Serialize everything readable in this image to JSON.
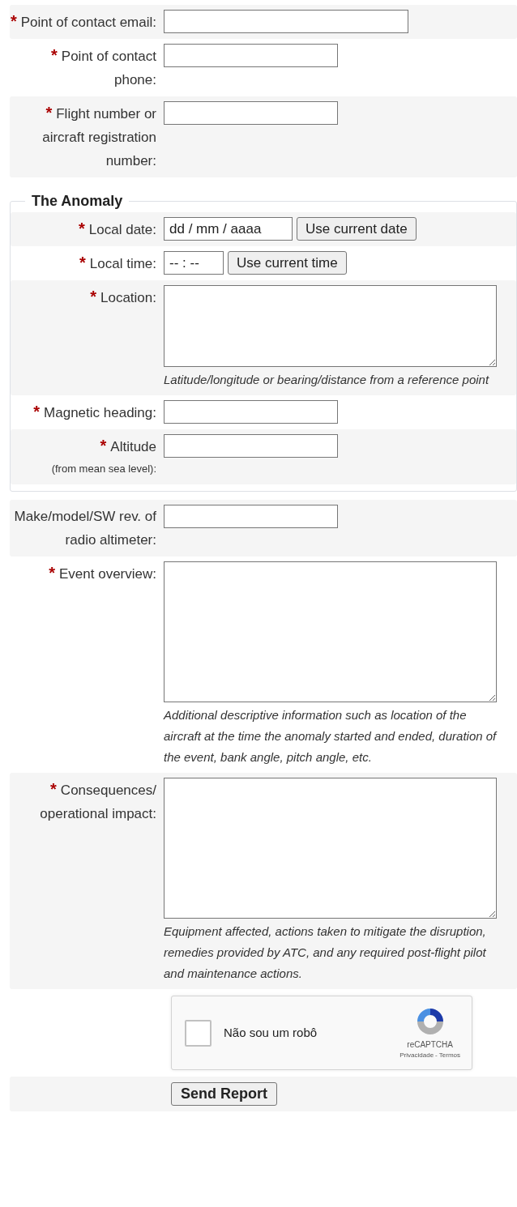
{
  "required_mark": "*",
  "contact_rows": [
    {
      "label": "Point of contact email:",
      "required": true,
      "kind": "wide_text"
    },
    {
      "label": "Point of contact phone:",
      "required": true,
      "kind": "text"
    },
    {
      "label": "Flight number or aircraft registration number:",
      "required": true,
      "kind": "text"
    }
  ],
  "anomaly": {
    "legend": "The Anomaly",
    "rows": [
      {
        "label": "Local date:",
        "required": true,
        "kind": "date",
        "placeholder": "dd / mm / aaaa",
        "button": "Use current date"
      },
      {
        "label": "Local time:",
        "required": true,
        "kind": "time",
        "placeholder": "-- : --",
        "button": "Use current time"
      },
      {
        "label": "Location:",
        "required": true,
        "kind": "textarea_short",
        "hint": "Latitude/longitude or bearing/distance from a reference point"
      },
      {
        "label": "Magnetic heading:",
        "required": true,
        "kind": "text"
      },
      {
        "label": "Altitude",
        "sublabel": "(from mean sea level):",
        "required": true,
        "kind": "text"
      }
    ]
  },
  "detail_rows": [
    {
      "label": "Make/model/SW rev. of radio altimeter:",
      "required": false,
      "kind": "text"
    },
    {
      "label": "Event overview:",
      "required": true,
      "kind": "textarea",
      "hint": "Additional descriptive information such as location of the aircraft at the time the anomaly started and ended, duration of the event, bank angle, pitch angle, etc."
    },
    {
      "label": "Consequences/ operational impact:",
      "required": true,
      "kind": "textarea",
      "hint": "Equipment affected, actions taken to mitigate the disruption, remedies provided by ATC, and any required post-flight pilot and maintenance actions."
    }
  ],
  "captcha": {
    "label": "Não sou um robô",
    "checked": false,
    "brand": "reCAPTCHA",
    "privacy": "Privacidade",
    "separator": "-",
    "terms": "Termos"
  },
  "submit": "Send Report"
}
